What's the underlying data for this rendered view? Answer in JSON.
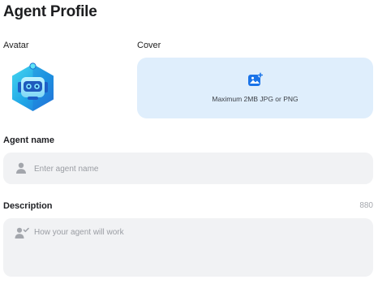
{
  "page": {
    "title": "Agent Profile"
  },
  "avatar": {
    "label": "Avatar",
    "icon": "robot-avatar-icon"
  },
  "cover": {
    "label": "Cover",
    "icon": "image-upload-icon",
    "hint": "Maximum 2MB JPG or PNG",
    "background_color": "#dfeefc",
    "accent_color": "#1a73e8"
  },
  "agent_name": {
    "label": "Agent name",
    "icon": "user-icon",
    "placeholder": "Enter agent name",
    "value": ""
  },
  "description": {
    "label": "Description",
    "counter": "880",
    "icon": "user-check-icon",
    "placeholder": "How your agent will work",
    "value": ""
  }
}
